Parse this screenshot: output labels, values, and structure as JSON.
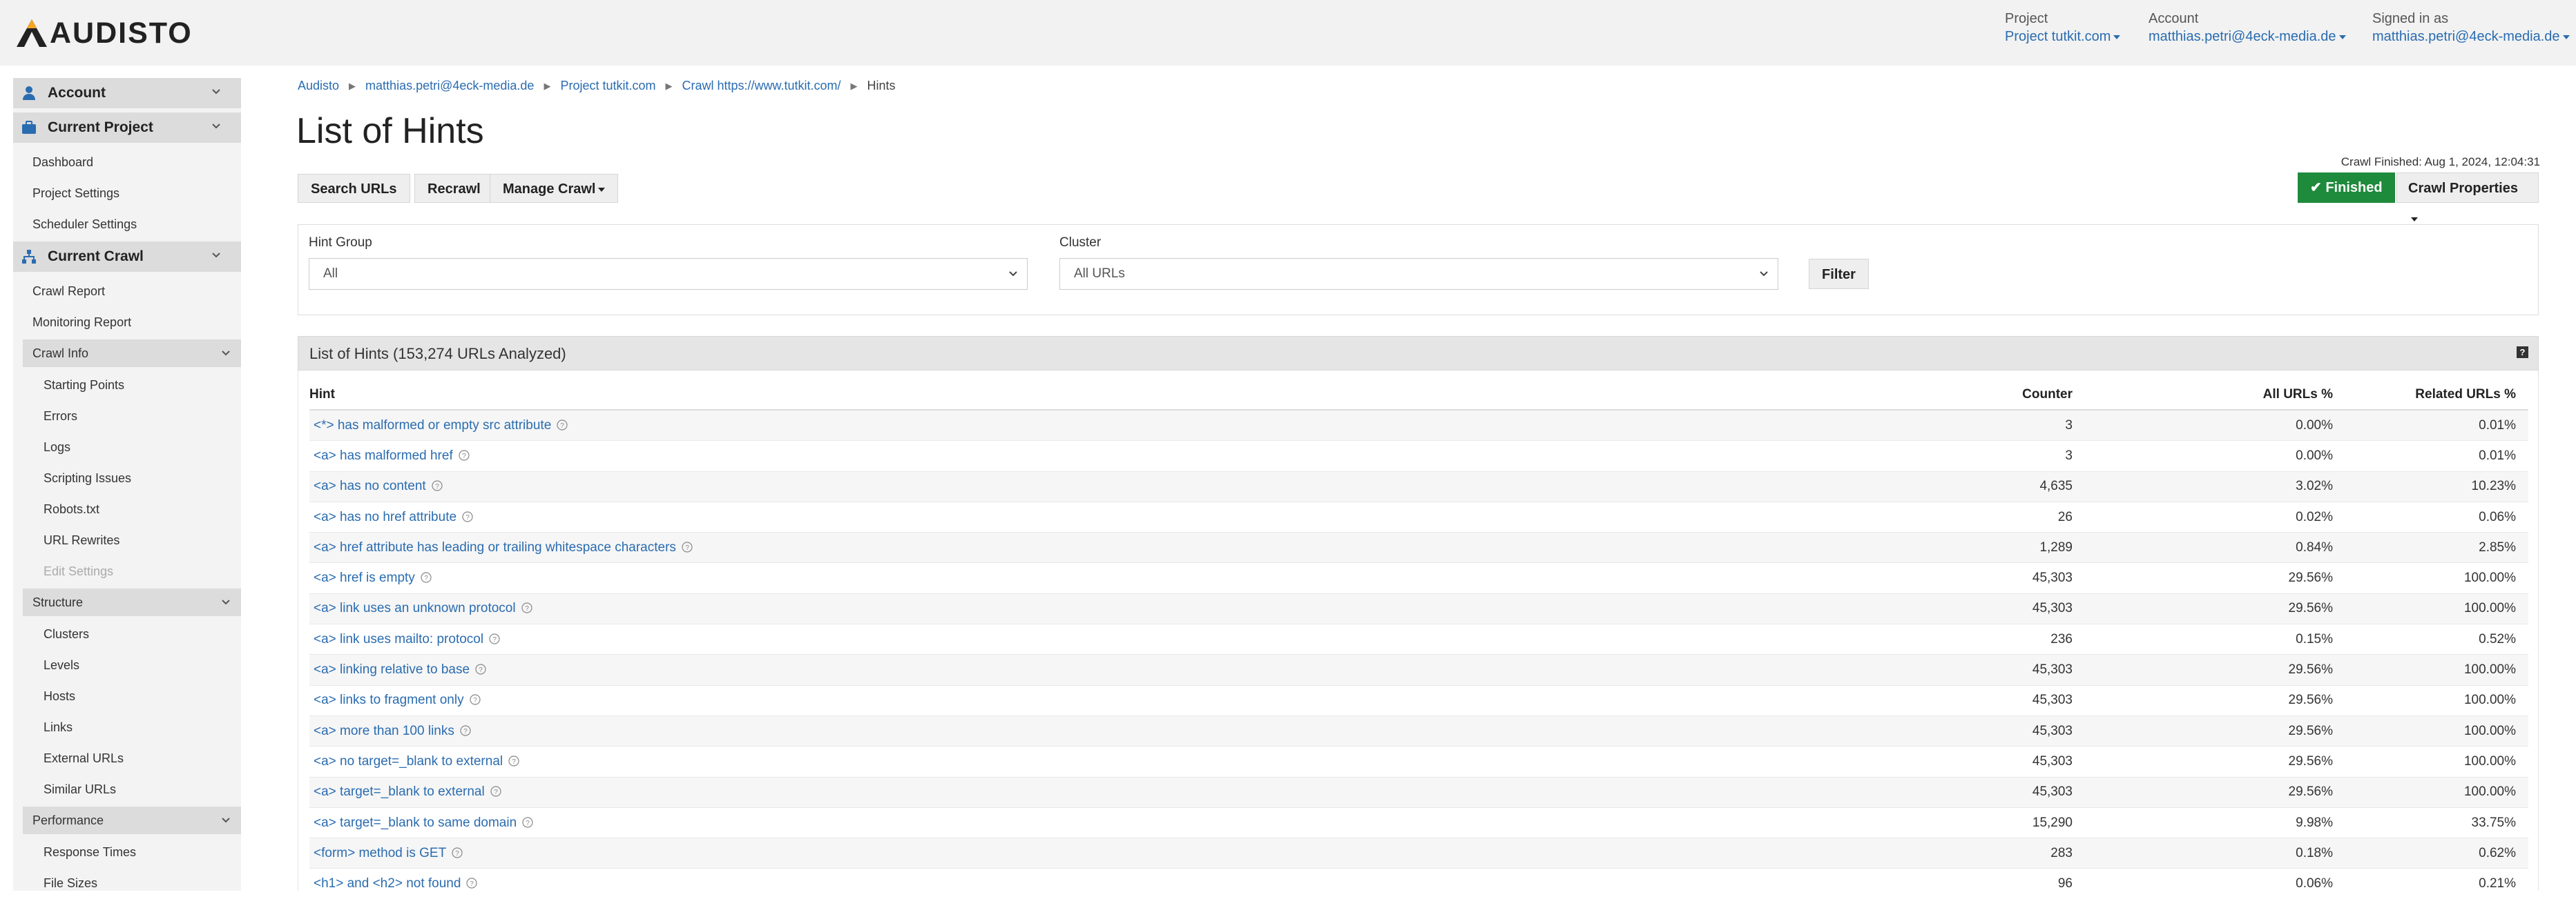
{
  "brand": "AUDISTO",
  "topnav": {
    "project_label": "Project",
    "project_value": "Project tutkit.com",
    "account_label": "Account",
    "account_value": "matthias.petri@4eck-media.de",
    "signed_label": "Signed in as",
    "signed_value": "matthias.petri@4eck-media.de"
  },
  "sidebar": {
    "account": "Account",
    "current_project": "Current Project",
    "project_items": [
      "Dashboard",
      "Project Settings",
      "Scheduler Settings"
    ],
    "current_crawl": "Current Crawl",
    "crawl_items": [
      "Crawl Report",
      "Monitoring Report"
    ],
    "crawl_info": "Crawl Info",
    "crawl_info_items": [
      "Starting Points",
      "Errors",
      "Logs",
      "Scripting Issues",
      "Robots.txt",
      "URL Rewrites",
      "Edit Settings"
    ],
    "structure": "Structure",
    "structure_items": [
      "Clusters",
      "Levels",
      "Hosts",
      "Links",
      "External URLs",
      "Similar URLs"
    ],
    "performance": "Performance",
    "performance_items": [
      "Response Times",
      "File Sizes"
    ]
  },
  "breadcrumb": [
    "Audisto",
    "matthias.petri@4eck-media.de",
    "Project tutkit.com",
    "Crawl https://www.tutkit.com/",
    "Hints"
  ],
  "page_title": "List of Hints",
  "toolbar": {
    "search_urls": "Search URLs",
    "recrawl": "Recrawl",
    "manage_crawl": "Manage Crawl",
    "crawl_finished": "Crawl Finished: Aug 1, 2024, 12:04:31",
    "finished": "Finished",
    "crawl_properties": "Crawl Properties"
  },
  "filter": {
    "hint_group_label": "Hint Group",
    "hint_group_value": "All",
    "cluster_label": "Cluster",
    "cluster_value": "All URLs",
    "filter_button": "Filter"
  },
  "panel": {
    "title": "List of Hints (153,274 URLs Analyzed)",
    "help": "?"
  },
  "table": {
    "headers": {
      "hint": "Hint",
      "counter": "Counter",
      "all": "All URLs %",
      "related": "Related URLs %"
    },
    "rows": [
      {
        "hint": "<*> has malformed or empty src attribute",
        "counter": "3",
        "all": "0.00%",
        "related": "0.01%"
      },
      {
        "hint": "<a> has malformed href",
        "counter": "3",
        "all": "0.00%",
        "related": "0.01%"
      },
      {
        "hint": "<a> has no content",
        "counter": "4,635",
        "all": "3.02%",
        "related": "10.23%"
      },
      {
        "hint": "<a> has no href attribute",
        "counter": "26",
        "all": "0.02%",
        "related": "0.06%"
      },
      {
        "hint": "<a> href attribute has leading or trailing whitespace characters",
        "counter": "1,289",
        "all": "0.84%",
        "related": "2.85%"
      },
      {
        "hint": "<a> href is empty",
        "counter": "45,303",
        "all": "29.56%",
        "related": "100.00%"
      },
      {
        "hint": "<a> link uses an unknown protocol",
        "counter": "45,303",
        "all": "29.56%",
        "related": "100.00%"
      },
      {
        "hint": "<a> link uses mailto: protocol",
        "counter": "236",
        "all": "0.15%",
        "related": "0.52%"
      },
      {
        "hint": "<a> linking relative to base",
        "counter": "45,303",
        "all": "29.56%",
        "related": "100.00%"
      },
      {
        "hint": "<a> links to fragment only",
        "counter": "45,303",
        "all": "29.56%",
        "related": "100.00%"
      },
      {
        "hint": "<a> more than 100 links",
        "counter": "45,303",
        "all": "29.56%",
        "related": "100.00%"
      },
      {
        "hint": "<a> no target=_blank to external",
        "counter": "45,303",
        "all": "29.56%",
        "related": "100.00%"
      },
      {
        "hint": "<a> target=_blank to external",
        "counter": "45,303",
        "all": "29.56%",
        "related": "100.00%"
      },
      {
        "hint": "<a> target=_blank to same domain",
        "counter": "15,290",
        "all": "9.98%",
        "related": "33.75%"
      },
      {
        "hint": "<form> method is GET",
        "counter": "283",
        "all": "0.18%",
        "related": "0.62%"
      },
      {
        "hint": "<h1> and <h2> not found",
        "counter": "96",
        "all": "0.06%",
        "related": "0.21%"
      }
    ]
  },
  "colors": {
    "link": "#2a6cb0",
    "finished_bg": "#1e8a3b",
    "sidebar_head": "#dcdcdc",
    "sidebar_bg": "#f3f3f3",
    "icon_blue": "#2a6cb0"
  }
}
